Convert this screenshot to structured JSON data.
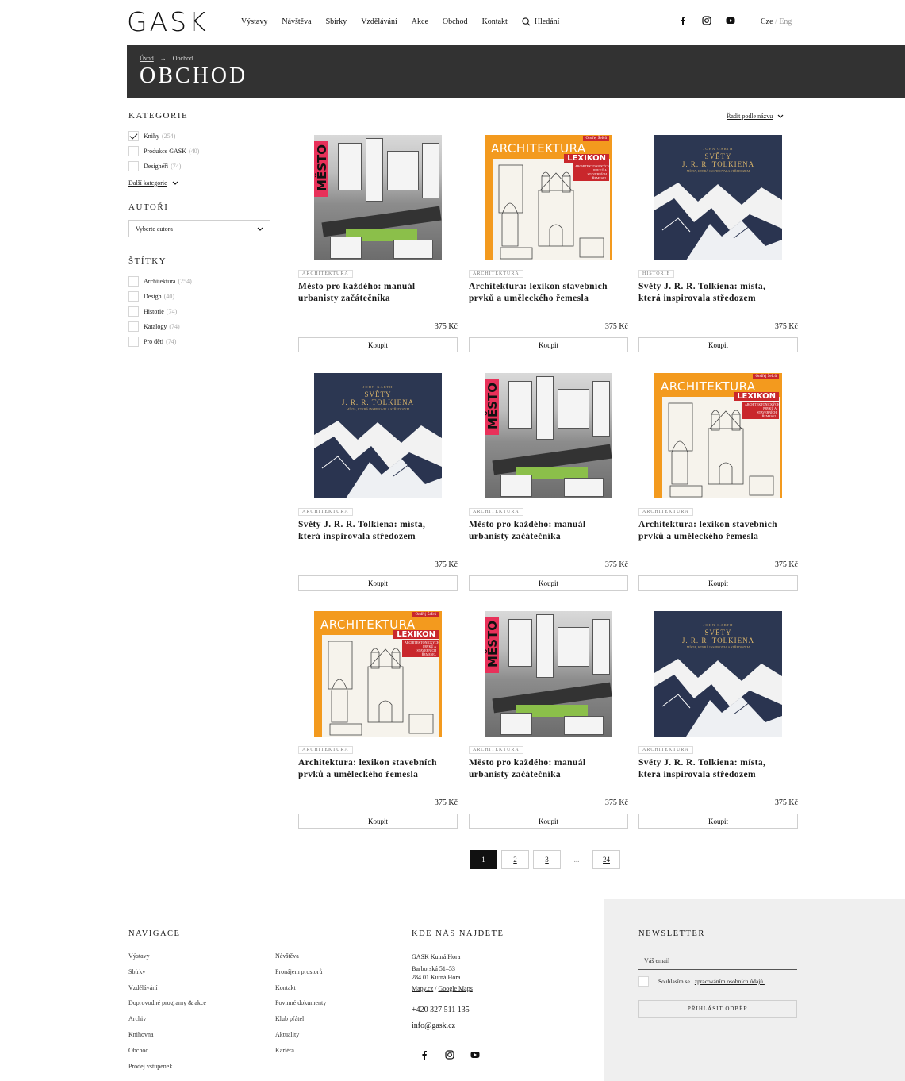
{
  "header": {
    "logo": "GASK",
    "nav": [
      "Výstavy",
      "Návštěva",
      "Sbírky",
      "Vzdělávání",
      "Akce",
      "Obchod",
      "Kontakt"
    ],
    "search_label": "Hledání",
    "lang_cz": "Cze",
    "lang_sep": "/",
    "lang_en": "Eng",
    "social_icons": [
      "facebook-icon",
      "instagram-icon",
      "youtube-icon"
    ]
  },
  "banner": {
    "breadcrumb_home": "Úvod",
    "breadcrumb_arrow": "→",
    "breadcrumb_current": "Obchod",
    "title": "OBCHOD"
  },
  "sidebar": {
    "categories_title": "KATEGORIE",
    "categories": [
      {
        "label": "Knihy",
        "count": "(254)",
        "checked": true
      },
      {
        "label": "Produkce GASK",
        "count": "(40)",
        "checked": false
      },
      {
        "label": "Designéři",
        "count": "(74)",
        "checked": false
      }
    ],
    "more_categories": "Další kategorie",
    "authors_title": "AUTOŘI",
    "authors_placeholder": "Vyberte autora",
    "tags_title": "ŠTÍTKY",
    "tags": [
      {
        "label": "Architektura",
        "count": "(254)"
      },
      {
        "label": "Design",
        "count": "(40)"
      },
      {
        "label": "Historie",
        "count": "(74)"
      },
      {
        "label": "Katalogy",
        "count": "(74)"
      },
      {
        "label": "Pro děti",
        "count": "(74)"
      }
    ]
  },
  "sort_label": "Řadit podle názvu",
  "covers": {
    "mesto_word": "MĚSTO",
    "arch_title": "ARCHITEKTURA",
    "arch_author": "Ondřej Šefců",
    "arch_lexikon": "LEXIKON",
    "arch_sub": "ARCHITEKTONICKÝCH PRVKŮ A STAVEBNÍCH ŘEMESEL",
    "tolk_author": "JOHN GARTH",
    "tolk_title_1": "SVĚTY",
    "tolk_title_2": "J. R. R. TOLKIENA",
    "tolk_sub": "MÍSTA, KTERÁ INSPIROVALA STŘEDOZEM"
  },
  "products": [
    {
      "cover": "mesto",
      "tag": "ARCHITEKTURA",
      "title": "Město pro každého: manuál urbanisty začátečníka",
      "price": "375 Kč",
      "buy": "Koupit"
    },
    {
      "cover": "arch",
      "tag": "ARCHITEKTURA",
      "title": "Architektura: lexikon stavebních prvků a uměleckého řemesla",
      "price": "375 Kč",
      "buy": "Koupit"
    },
    {
      "cover": "tolk",
      "tag": "HISTORIE",
      "title": "Světy J. R. R. Tolkiena: místa, která inspirovala středozem",
      "price": "375 Kč",
      "buy": "Koupit"
    },
    {
      "cover": "tolk",
      "tag": "ARCHITEKTURA",
      "title": "Světy J. R. R. Tolkiena: místa, která inspirovala středozem",
      "price": "375 Kč",
      "buy": "Koupit"
    },
    {
      "cover": "mesto",
      "tag": "ARCHITEKTURA",
      "title": "Město pro každého: manuál urbanisty začátečníka",
      "price": "375 Kč",
      "buy": "Koupit"
    },
    {
      "cover": "arch",
      "tag": "ARCHITEKTURA",
      "title": "Architektura: lexikon stavebních prvků a uměleckého řemesla",
      "price": "375 Kč",
      "buy": "Koupit"
    },
    {
      "cover": "arch",
      "tag": "ARCHITEKTURA",
      "title": "Architektura: lexikon stavebních prvků a uměleckého řemesla",
      "price": "375 Kč",
      "buy": "Koupit"
    },
    {
      "cover": "mesto",
      "tag": "ARCHITEKTURA",
      "title": "Město pro každého: manuál urbanisty začátečníka",
      "price": "375 Kč",
      "buy": "Koupit"
    },
    {
      "cover": "tolk",
      "tag": "ARCHITEKTURA",
      "title": "Světy J. R. R. Tolkiena: místa, která inspirovala středozem",
      "price": "375 Kč",
      "buy": "Koupit"
    }
  ],
  "pagination": {
    "pages": [
      "1",
      "2",
      "3"
    ],
    "dots": "...",
    "last": "24",
    "active": "1"
  },
  "footer": {
    "nav_title": "NAVIGACE",
    "nav_col1": [
      "Výstavy",
      "Sbírky",
      "Vzdělávání",
      "Doprovodné programy & akce",
      "Archiv",
      "Knihovna",
      "Obchod",
      "Prodej vstupenek"
    ],
    "nav_col2": [
      "Návštěva",
      "Pronájem prostorů",
      "Kontakt",
      "Povinné dokumenty",
      "Klub přátel",
      "Aktuality",
      "Kariéra"
    ],
    "find_title": "KDE NÁS NAJDETE",
    "org_name": "GASK Kutná Hora",
    "address_1": "Barborská 51–53",
    "address_2": "284 01 Kutná Hora",
    "maps_1": "Mapy.cz",
    "maps_sep": "/",
    "maps_2": "Google Maps",
    "phone": "+420 327 511 135",
    "email": "info@gask.cz",
    "newsletter_title": "NEWSLETTER",
    "email_placeholder": "Váš email",
    "consent_prefix": "Souhlasím se",
    "consent_link": "zpracováním osobních údajů.",
    "subscribe": "PŘIHLÁSIT ODBĚR"
  }
}
